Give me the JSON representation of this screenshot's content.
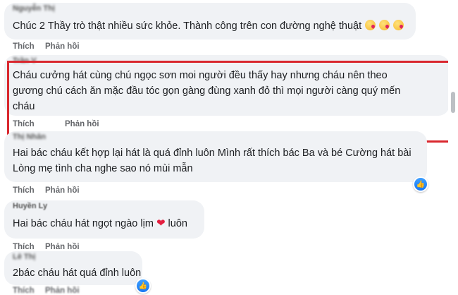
{
  "comments": [
    {
      "author": "Nguyễn Thị",
      "lines": [
        "Chúc 2 Thầy trò thật nhiều sức khỏe. Thành công trên con đường nghệ thuật"
      ],
      "actions": [
        "Thích",
        "Phản hồi"
      ]
    },
    {
      "author": "Trần V",
      "lines": [
        "Cháu cưởng hát cùng chú ngọc sơn moi người đều thấy hay nhưng cháu nên theo",
        "gương chú cách ăn mặc đầu tóc gọn gàng đùng xanh đỏ thì mọi người càng quý mến",
        "cháu"
      ],
      "actions": [
        "Thích",
        "Phản hồi"
      ]
    },
    {
      "author": "Thị Nhân",
      "lines": [
        "Hai bác cháu kết hợp lại hát là quá đỉnh luôn Mình rất thích bác Ba và bé Cường hát bài",
        "Lòng mẹ tình cha nghe sao nó mùi mẫn"
      ],
      "actions": [
        "Thích",
        "Phản hồi"
      ]
    },
    {
      "author": "Huyền Ly",
      "lines": [
        "Hai bác cháu hát ngọt ngào lịm",
        "luôn"
      ],
      "actions": [
        "Thích",
        "Phản hồi"
      ]
    },
    {
      "author": "Lê Thị",
      "lines": [
        "2bác cháu hát quá đỉnh luôn"
      ],
      "actions": [
        "Thích",
        "Phản hồi"
      ]
    }
  ],
  "icons": {
    "emoji": "face-blowing-kiss-icon",
    "heart": "red-heart-icon",
    "like": "like-reaction-icon"
  },
  "colors": {
    "highlight": "#d9272e",
    "bubble": "#f0f2f5",
    "like": "#1877f2"
  }
}
